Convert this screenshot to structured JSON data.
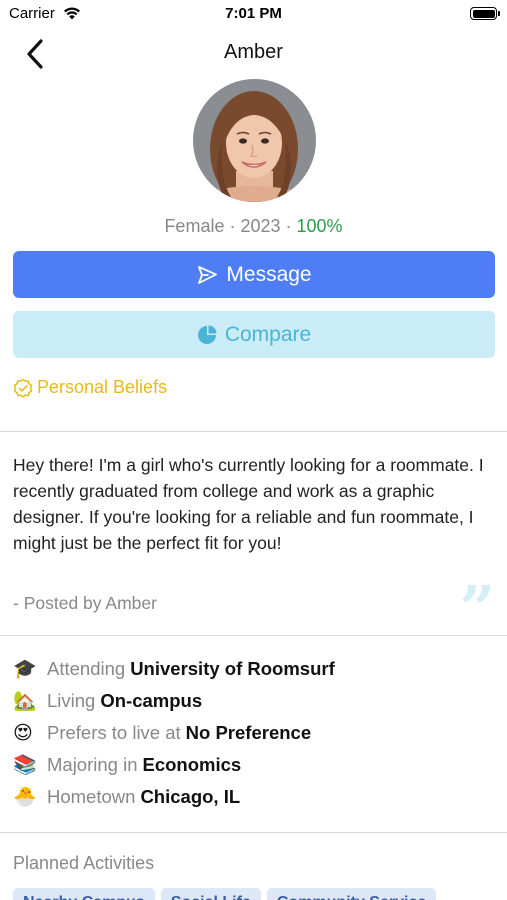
{
  "status_bar": {
    "carrier": "Carrier",
    "time": "7:01 PM"
  },
  "nav": {
    "title": "Amber"
  },
  "profile": {
    "gender": "Female",
    "separator": " · ",
    "year": "2023",
    "match": "100%",
    "match_color": "#2e9d4a"
  },
  "actions": {
    "message_label": "Message",
    "compare_label": "Compare",
    "beliefs_label": "Personal Beliefs",
    "message_color": "#4f7df6",
    "compare_color": "#c9ecf6",
    "beliefs_color": "#e8b916"
  },
  "bio": {
    "text": "Hey there! I'm a girl who's currently looking for a roommate. I recently graduated from college and work as a graphic designer. If you're looking for a reliable and fun roommate, I might just be the perfect fit for you!",
    "posted_by": "- Posted by Amber"
  },
  "info": [
    {
      "icon": "graduation-cap-icon",
      "emoji": "🎓",
      "prefix": "Attending",
      "value": "University of Roomsurf"
    },
    {
      "icon": "house-icon",
      "emoji": "🏡",
      "prefix": "Living",
      "value": "On-campus"
    },
    {
      "icon": "heart-eyes-icon",
      "emoji": "😍",
      "prefix": "Prefers to live at",
      "value": "No Preference"
    },
    {
      "icon": "books-icon",
      "emoji": "📚",
      "prefix": "Majoring in",
      "value": "Economics"
    },
    {
      "icon": "hatching-chick-icon",
      "emoji": "🐣",
      "prefix": "Hometown",
      "value": "Chicago, IL"
    }
  ],
  "activities": {
    "title": "Planned Activities",
    "chips": [
      "Nearby Campus",
      "Social Life",
      "Community Service"
    ]
  }
}
